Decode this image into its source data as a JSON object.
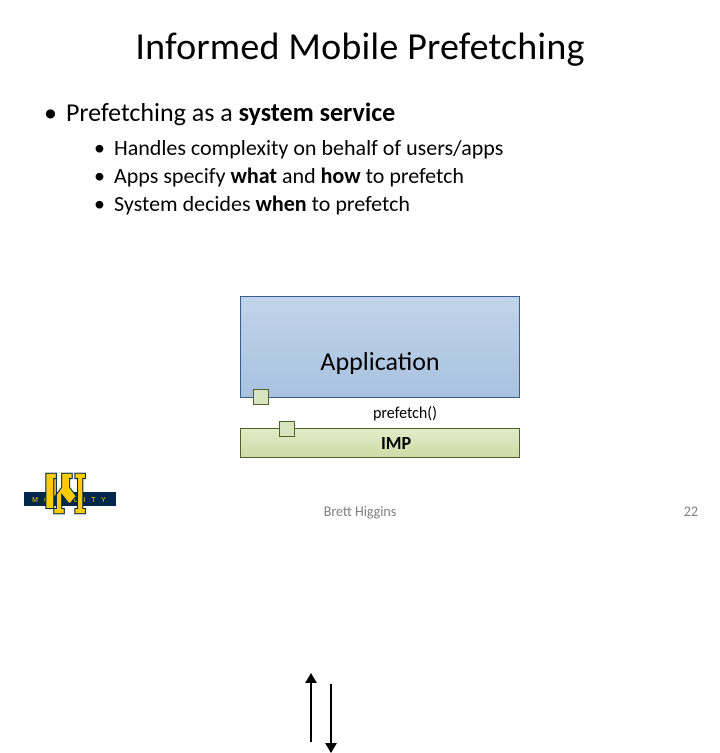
{
  "title": "Informed Mobile Prefetching",
  "bullet_main_pre": "Prefetching as a ",
  "bullet_main_bold": "system service",
  "sub_bullets": {
    "b0": "Handles complexity on behalf of users/apps",
    "b1_pre": "Apps specify ",
    "b1_b1": "what",
    "b1_mid": " and ",
    "b1_b2": "how",
    "b1_post": " to prefetch",
    "b2_pre": "System decides ",
    "b2_b": "when",
    "b2_post": " to prefetch"
  },
  "diagram": {
    "app_label": "Application",
    "prefetch_label": "prefetch()",
    "imp_label": "IMP"
  },
  "logo_text": "M O B I L I T Y",
  "footer": {
    "author": "Brett Higgins",
    "page": "22"
  }
}
